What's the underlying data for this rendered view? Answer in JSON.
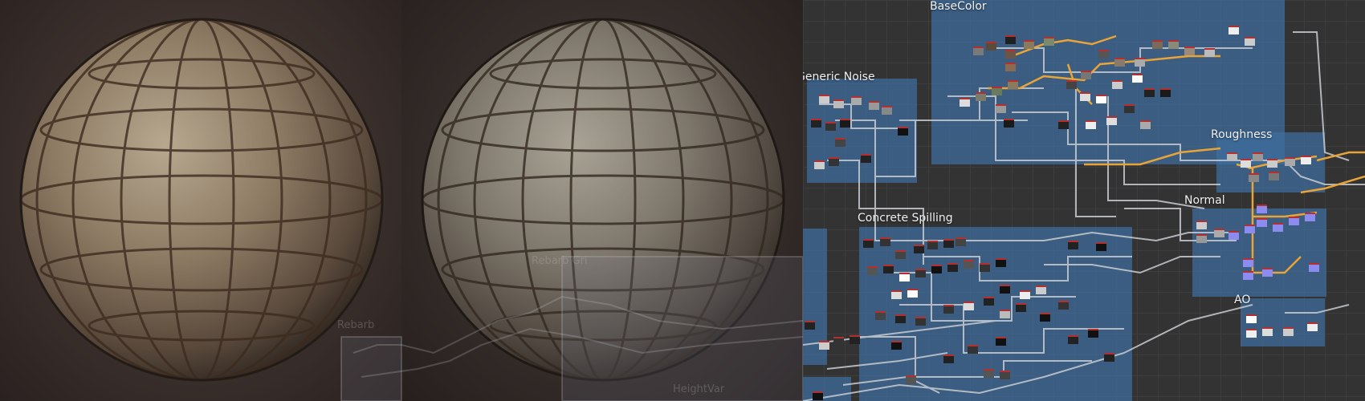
{
  "viewports": [
    {
      "id": "render-left"
    },
    {
      "id": "render-middle"
    }
  ],
  "graph": {
    "frames": [
      {
        "id": "basecolor",
        "title": "BaseColor"
      },
      {
        "id": "generic-noise",
        "title": "Generic Noise"
      },
      {
        "id": "roughness",
        "title": "Roughness"
      },
      {
        "id": "normal",
        "title": "Normal"
      },
      {
        "id": "concrete-spilling",
        "title": "Concrete Spilling"
      },
      {
        "id": "ao",
        "title": "AO"
      },
      {
        "id": "extra-left"
      },
      {
        "id": "extra-bottom"
      }
    ],
    "ghost_labels": [
      "Rebarb",
      "Rebarb Gri",
      "HeightVar"
    ]
  },
  "colors": {
    "frame_fill": "#3f6ea0",
    "wire": "#c8ccd2",
    "wire_highlight": "#e8a437",
    "node_header": "#b43030",
    "node_normal": "#8c8cf0"
  }
}
